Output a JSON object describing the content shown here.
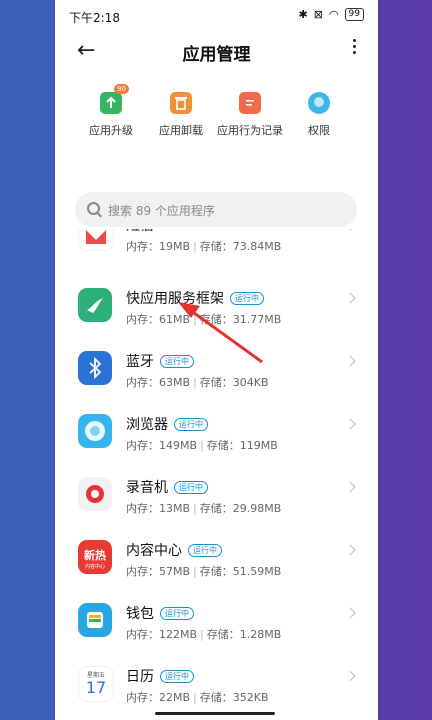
{
  "status": {
    "time": "下午2:18",
    "battery": "99",
    "icons": [
      "bluetooth-icon",
      "close-box-icon",
      "wifi-icon"
    ]
  },
  "header": {
    "title": "应用管理",
    "back": "←"
  },
  "tools": [
    {
      "label": "应用升级",
      "icon": "upload-icon",
      "badge": "90",
      "color": "#35b561"
    },
    {
      "label": "应用卸载",
      "icon": "trash-icon",
      "color": "#f2913a"
    },
    {
      "label": "应用行为记录",
      "icon": "document-icon",
      "color": "#f06a4a"
    },
    {
      "label": "权限",
      "icon": "shield-person-icon",
      "color": "#3bb6e6"
    }
  ],
  "search": {
    "placeholder": "搜索 89 个应用程序"
  },
  "labels": {
    "mem": "内存：",
    "store": "存储：",
    "running": "运行中"
  },
  "apps": [
    {
      "name": "短信",
      "mem": "19MB",
      "store": "73.84MB",
      "running": false,
      "color": "#f04a4a"
    },
    {
      "name": "快应用服务框架",
      "mem": "61MB",
      "store": "31.77MB",
      "running": true,
      "color": "#2fb07a"
    },
    {
      "name": "蓝牙",
      "mem": "63MB",
      "store": "304KB",
      "running": true,
      "color": "#2b72d6"
    },
    {
      "name": "浏览器",
      "mem": "149MB",
      "store": "119MB",
      "running": true,
      "color": "#36b4ee"
    },
    {
      "name": "录音机",
      "mem": "13MB",
      "store": "29.98MB",
      "running": true,
      "color": "#e8333a"
    },
    {
      "name": "内容中心",
      "mem": "57MB",
      "store": "51.59MB",
      "running": true,
      "color": "#e63a32"
    },
    {
      "name": "钱包",
      "mem": "122MB",
      "store": "1.28MB",
      "running": true,
      "color": "#2aa7e3"
    },
    {
      "name": "日历",
      "mem": "22MB",
      "store": "352KB",
      "running": true,
      "color": "#2b72d6"
    }
  ],
  "calendar_icon": {
    "weekday": "星期五",
    "day": "17"
  },
  "content_center_icon": {
    "big": "新热",
    "small": "内容中心"
  }
}
